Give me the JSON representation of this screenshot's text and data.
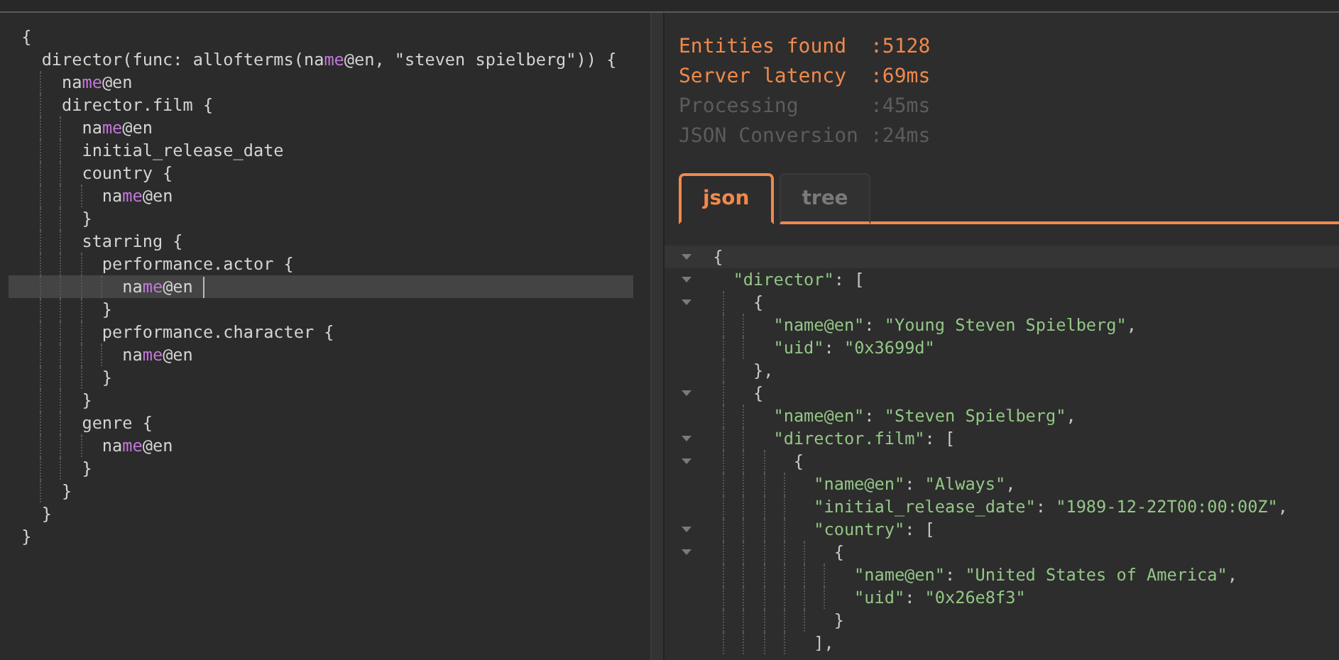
{
  "query_editor": {
    "lines": [
      {
        "current": false,
        "tokens": [
          {
            "text": "{"
          }
        ]
      },
      {
        "current": false,
        "tokens": [
          {
            "text": "  director(func: allofterms(na"
          },
          {
            "text": "me",
            "kind": "keyword"
          },
          {
            "text": "@en, \"steven spielberg\")) {"
          }
        ]
      },
      {
        "current": false,
        "tokens": [
          {
            "text": "    na"
          },
          {
            "text": "me",
            "kind": "keyword"
          },
          {
            "text": "@en"
          }
        ]
      },
      {
        "current": false,
        "tokens": [
          {
            "text": "    director.film {"
          }
        ]
      },
      {
        "current": false,
        "tokens": [
          {
            "text": "      na"
          },
          {
            "text": "me",
            "kind": "keyword"
          },
          {
            "text": "@en"
          }
        ]
      },
      {
        "current": false,
        "tokens": [
          {
            "text": "      initial_release_date"
          }
        ]
      },
      {
        "current": false,
        "tokens": [
          {
            "text": "      country {"
          }
        ]
      },
      {
        "current": false,
        "tokens": [
          {
            "text": "        na"
          },
          {
            "text": "me",
            "kind": "keyword"
          },
          {
            "text": "@en"
          }
        ]
      },
      {
        "current": false,
        "tokens": [
          {
            "text": "      }"
          }
        ]
      },
      {
        "current": false,
        "tokens": [
          {
            "text": "      starring {"
          }
        ]
      },
      {
        "current": false,
        "tokens": [
          {
            "text": "        performance.actor {"
          }
        ]
      },
      {
        "current": true,
        "tokens": [
          {
            "text": "          na"
          },
          {
            "text": "me",
            "kind": "keyword"
          },
          {
            "text": "@en"
          }
        ]
      },
      {
        "current": false,
        "tokens": [
          {
            "text": "        }"
          }
        ]
      },
      {
        "current": false,
        "tokens": [
          {
            "text": "        performance.character {"
          }
        ]
      },
      {
        "current": false,
        "tokens": [
          {
            "text": "          na"
          },
          {
            "text": "me",
            "kind": "keyword"
          },
          {
            "text": "@en"
          }
        ]
      },
      {
        "current": false,
        "tokens": [
          {
            "text": "        }"
          }
        ]
      },
      {
        "current": false,
        "tokens": [
          {
            "text": "      }"
          }
        ]
      },
      {
        "current": false,
        "tokens": [
          {
            "text": "      genre {"
          }
        ]
      },
      {
        "current": false,
        "tokens": [
          {
            "text": "        na"
          },
          {
            "text": "me",
            "kind": "keyword"
          },
          {
            "text": "@en"
          }
        ]
      },
      {
        "current": false,
        "tokens": [
          {
            "text": "      }"
          }
        ]
      },
      {
        "current": false,
        "tokens": [
          {
            "text": "    }"
          }
        ]
      },
      {
        "current": false,
        "tokens": [
          {
            "text": "  }"
          }
        ]
      },
      {
        "current": false,
        "tokens": [
          {
            "text": "}"
          }
        ]
      }
    ]
  },
  "stats": [
    {
      "label": "Entities found",
      "value": ":5128",
      "highlighted": true
    },
    {
      "label": "Server latency",
      "value": ":69ms",
      "highlighted": true
    },
    {
      "label": "Processing",
      "value": ":45ms",
      "highlighted": false
    },
    {
      "label": "JSON Conversion",
      "value": ":24ms",
      "highlighted": false
    }
  ],
  "tabs": [
    {
      "label": "json",
      "selected": true
    },
    {
      "label": "tree",
      "selected": false
    }
  ],
  "result_viewer": {
    "lines": [
      {
        "fold": true,
        "current": true,
        "text": "{"
      },
      {
        "fold": true,
        "current": false,
        "text": "  \"director\": ["
      },
      {
        "fold": true,
        "current": false,
        "text": "    {"
      },
      {
        "fold": false,
        "current": false,
        "text": "      \"name@en\": \"Young Steven Spielberg\","
      },
      {
        "fold": false,
        "current": false,
        "text": "      \"uid\": \"0x3699d\""
      },
      {
        "fold": false,
        "current": false,
        "text": "    },"
      },
      {
        "fold": true,
        "current": false,
        "text": "    {"
      },
      {
        "fold": false,
        "current": false,
        "text": "      \"name@en\": \"Steven Spielberg\","
      },
      {
        "fold": true,
        "current": false,
        "text": "      \"director.film\": ["
      },
      {
        "fold": true,
        "current": false,
        "text": "        {"
      },
      {
        "fold": false,
        "current": false,
        "text": "          \"name@en\": \"Always\","
      },
      {
        "fold": false,
        "current": false,
        "text": "          \"initial_release_date\": \"1989-12-22T00:00:00Z\","
      },
      {
        "fold": true,
        "current": false,
        "text": "          \"country\": ["
      },
      {
        "fold": true,
        "current": false,
        "text": "            {"
      },
      {
        "fold": false,
        "current": false,
        "text": "              \"name@en\": \"United States of America\","
      },
      {
        "fold": false,
        "current": false,
        "text": "              \"uid\": \"0x26e8f3\""
      },
      {
        "fold": false,
        "current": false,
        "text": "            }"
      },
      {
        "fold": false,
        "current": false,
        "text": "          ],"
      }
    ]
  }
}
